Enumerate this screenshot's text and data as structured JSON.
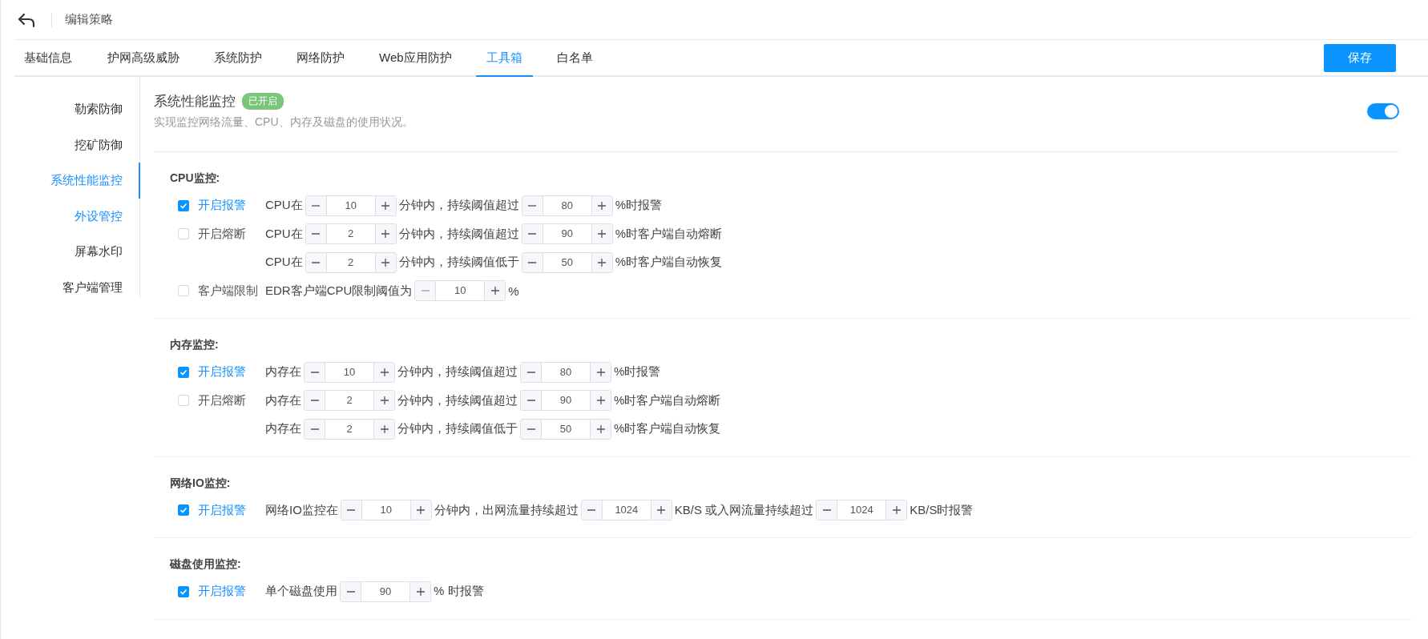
{
  "header": {
    "title": "编辑策略"
  },
  "tabs": [
    {
      "label": "基础信息",
      "selected": false
    },
    {
      "label": "护网高级威胁",
      "selected": false
    },
    {
      "label": "系统防护",
      "selected": false
    },
    {
      "label": "网络防护",
      "selected": false
    },
    {
      "label": "Web应用防护",
      "selected": false
    },
    {
      "label": "工具箱",
      "selected": true
    },
    {
      "label": "白名单",
      "selected": false
    }
  ],
  "save_button": "保存",
  "sidebar": {
    "items": [
      {
        "label": "勒索防御",
        "selected": false,
        "hovered": false
      },
      {
        "label": "挖矿防御",
        "selected": false,
        "hovered": false
      },
      {
        "label": "系统性能监控",
        "selected": true,
        "hovered": false
      },
      {
        "label": "外设管控",
        "selected": false,
        "hovered": true
      },
      {
        "label": "屏幕水印",
        "selected": false,
        "hovered": false
      },
      {
        "label": "客户端管理",
        "selected": false,
        "hovered": false
      }
    ]
  },
  "panel": {
    "title": "系统性能监控",
    "badge": "已开启",
    "description": "实现监控网络流量、CPU、内存及磁盘的使用状况。",
    "enabled": true
  },
  "sections": [
    {
      "title": "CPU监控:",
      "rows": [
        {
          "checkbox": {
            "label": "开启报警",
            "checked": true
          },
          "parts": [
            {
              "kind": "text",
              "text": "CPU在"
            },
            {
              "kind": "stepper",
              "value": "10",
              "decrease_disabled": false
            },
            {
              "kind": "text",
              "text": "分钟内，持续阈值超过"
            },
            {
              "kind": "stepper",
              "value": "80",
              "decrease_disabled": false
            },
            {
              "kind": "text",
              "text": "%时报警"
            }
          ]
        },
        {
          "checkbox": {
            "label": "开启熔断",
            "checked": false
          },
          "parts": [
            {
              "kind": "text",
              "text": "CPU在"
            },
            {
              "kind": "stepper",
              "value": "2",
              "decrease_disabled": false
            },
            {
              "kind": "text",
              "text": "分钟内，持续阈值超过"
            },
            {
              "kind": "stepper",
              "value": "90",
              "decrease_disabled": false
            },
            {
              "kind": "text",
              "text": "%时客户端自动熔断"
            }
          ]
        },
        {
          "parts": [
            {
              "kind": "text",
              "text": "CPU在"
            },
            {
              "kind": "stepper",
              "value": "2",
              "decrease_disabled": false
            },
            {
              "kind": "text",
              "text": "分钟内，持续阈值低于"
            },
            {
              "kind": "stepper",
              "value": "50",
              "decrease_disabled": false
            },
            {
              "kind": "text",
              "text": "%时客户端自动恢复"
            }
          ]
        },
        {
          "checkbox": {
            "label": "客户端限制",
            "checked": false
          },
          "parts": [
            {
              "kind": "text",
              "text": "EDR客户端CPU限制阈值为"
            },
            {
              "kind": "stepper",
              "value": "10",
              "decrease_disabled": true
            },
            {
              "kind": "text",
              "text": "%"
            }
          ]
        }
      ]
    },
    {
      "title": "内存监控:",
      "rows": [
        {
          "checkbox": {
            "label": "开启报警",
            "checked": true
          },
          "parts": [
            {
              "kind": "text",
              "text": "内存在"
            },
            {
              "kind": "stepper",
              "value": "10",
              "decrease_disabled": false
            },
            {
              "kind": "text",
              "text": "分钟内，持续阈值超过"
            },
            {
              "kind": "stepper",
              "value": "80",
              "decrease_disabled": false
            },
            {
              "kind": "text",
              "text": "%时报警"
            }
          ]
        },
        {
          "checkbox": {
            "label": "开启熔断",
            "checked": false
          },
          "parts": [
            {
              "kind": "text",
              "text": "内存在"
            },
            {
              "kind": "stepper",
              "value": "2",
              "decrease_disabled": false
            },
            {
              "kind": "text",
              "text": "分钟内，持续阈值超过"
            },
            {
              "kind": "stepper",
              "value": "90",
              "decrease_disabled": false
            },
            {
              "kind": "text",
              "text": "%时客户端自动熔断"
            }
          ]
        },
        {
          "parts": [
            {
              "kind": "text",
              "text": "内存在"
            },
            {
              "kind": "stepper",
              "value": "2",
              "decrease_disabled": false
            },
            {
              "kind": "text",
              "text": "分钟内，持续阈值低于"
            },
            {
              "kind": "stepper",
              "value": "50",
              "decrease_disabled": false
            },
            {
              "kind": "text",
              "text": "%时客户端自动恢复"
            }
          ]
        }
      ]
    },
    {
      "title": "网络IO监控:",
      "rows": [
        {
          "checkbox": {
            "label": "开启报警",
            "checked": true
          },
          "parts": [
            {
              "kind": "text",
              "text": "网络IO监控在"
            },
            {
              "kind": "stepper",
              "value": "10",
              "decrease_disabled": false
            },
            {
              "kind": "text",
              "text": "分钟内，出网流量持续超过"
            },
            {
              "kind": "stepper",
              "value": "1024",
              "decrease_disabled": false
            },
            {
              "kind": "text",
              "text": "KB/S 或入网流量持续超过"
            },
            {
              "kind": "stepper",
              "value": "1024",
              "decrease_disabled": false
            },
            {
              "kind": "text",
              "text": "KB/S时报警"
            }
          ]
        }
      ]
    },
    {
      "title": "磁盘使用监控:",
      "rows": [
        {
          "checkbox": {
            "label": "开启报警",
            "checked": true
          },
          "parts": [
            {
              "kind": "text",
              "text": "单个磁盘使用"
            },
            {
              "kind": "stepper",
              "value": "90",
              "decrease_disabled": false
            },
            {
              "kind": "text",
              "text": "% 时报警"
            }
          ]
        }
      ]
    }
  ]
}
